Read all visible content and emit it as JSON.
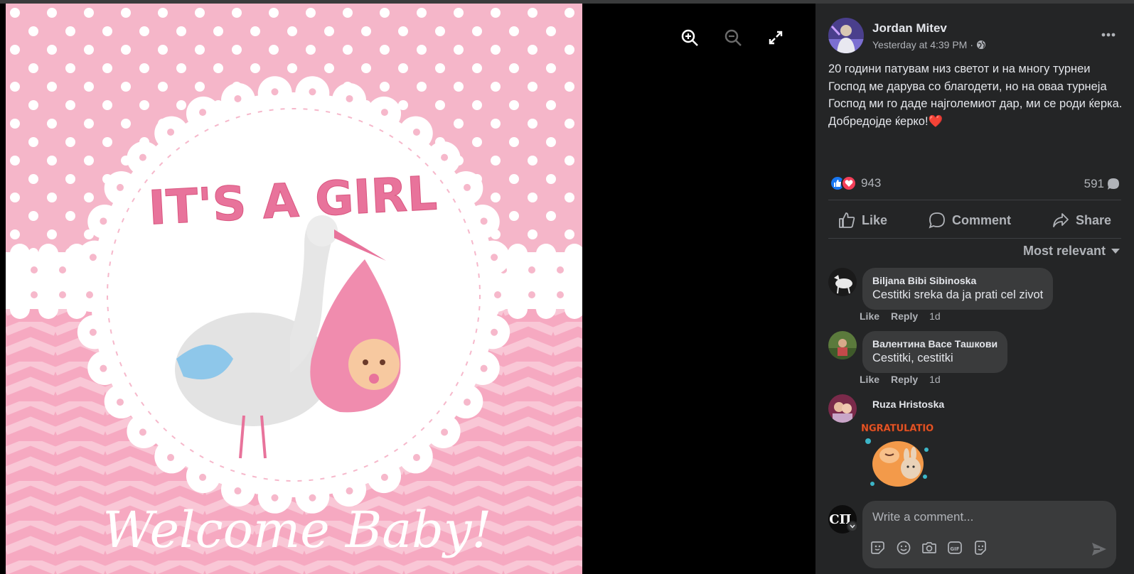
{
  "post": {
    "author": "Jordan Mitev",
    "timestamp": "Yesterday at 4:39 PM",
    "separator": "·",
    "text_lines": [
      "20 години патувам низ светот и на многу турнеи Господ ме дарува со благодети, но на оваа турнеја Господ ми го даде најголемиот дар, ми се роди ќерка.",
      "Добредојде ќерко!"
    ],
    "heart_emoji": "❤️"
  },
  "photo": {
    "headline": "IT'S A GIRL",
    "footer": "Welcome Baby!"
  },
  "reactions": {
    "count": "943",
    "comments": "591"
  },
  "actions": {
    "like": "Like",
    "comment": "Comment",
    "share": "Share"
  },
  "sort": {
    "label": "Most relevant"
  },
  "comments": [
    {
      "name": "Biljana Bibi Sibinoska",
      "text": "Cestitki sreka da ja prati cel zivot",
      "like": "Like",
      "reply": "Reply",
      "time": "1d"
    },
    {
      "name": "Валентина Васе Ташкови",
      "text": "Cestitki, cestitki",
      "like": "Like",
      "reply": "Reply",
      "time": "1d"
    },
    {
      "name": "Ruza Hristoska",
      "sticker_text": "CONGRATULATIONS"
    }
  ],
  "composer": {
    "placeholder": "Write a comment...",
    "avatar_text": "СП."
  },
  "icons": {
    "viewer": [
      "zoom-in-icon",
      "zoom-out-icon",
      "fullscreen-icon"
    ],
    "composer_tools": [
      "sticker-icon",
      "emoji-icon",
      "camera-icon",
      "gif-icon",
      "avatar-sticker-icon"
    ]
  },
  "colors": {
    "panel": "#242526",
    "bubble": "#3a3b3c",
    "text": "#e4e6eb",
    "muted": "#b0b3b8",
    "like_blue": "#1877f2",
    "love_red": "#f33e58",
    "pink": "#e8739b"
  }
}
